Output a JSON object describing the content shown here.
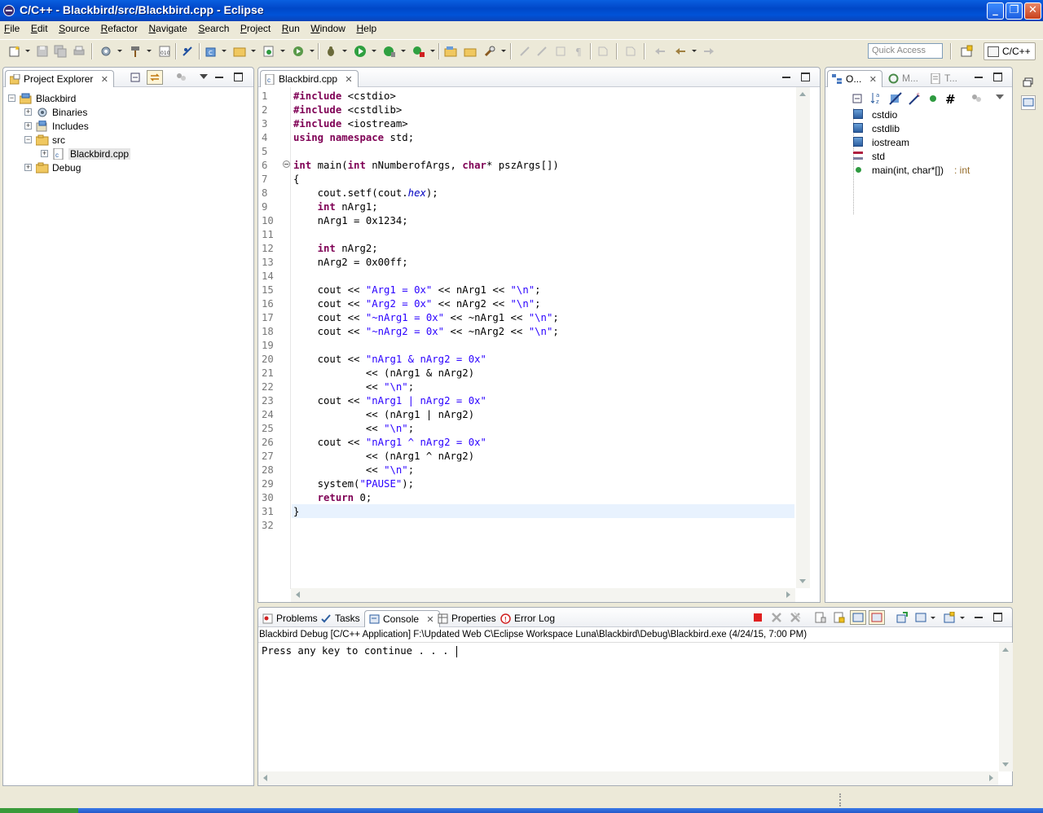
{
  "window": {
    "title": "C/C++ - Blackbird/src/Blackbird.cpp - Eclipse"
  },
  "menu": [
    "File",
    "Edit",
    "Source",
    "Refactor",
    "Navigate",
    "Search",
    "Project",
    "Run",
    "Window",
    "Help"
  ],
  "toolbar": {
    "quick_access_placeholder": "Quick Access",
    "perspective": "C/C++"
  },
  "project_explorer": {
    "tab_label": "Project Explorer",
    "tree": [
      {
        "label": "Blackbird",
        "icon": "project-icon",
        "expanded": true
      },
      {
        "label": "Binaries",
        "icon": "binaries-icon"
      },
      {
        "label": "Includes",
        "icon": "includes-icon"
      },
      {
        "label": "src",
        "icon": "folder-icon",
        "expanded": true
      },
      {
        "label": "Blackbird.cpp",
        "icon": "cpp-file-icon"
      },
      {
        "label": "Debug",
        "icon": "folder-icon"
      }
    ]
  },
  "editor": {
    "tab_label": "Blackbird.cpp",
    "line_numbers": [
      "1",
      "2",
      "3",
      "4",
      "5",
      "6",
      "7",
      "8",
      "9",
      "10",
      "11",
      "12",
      "13",
      "14",
      "15",
      "16",
      "17",
      "18",
      "19",
      "20",
      "21",
      "22",
      "23",
      "24",
      "25",
      "26",
      "27",
      "28",
      "29",
      "30",
      "31",
      "32"
    ],
    "lines": [
      "#include <cstdio>",
      "#include <cstdlib>",
      "#include <iostream>",
      "using namespace std;",
      "",
      "int main(int nNumberofArgs, char* pszArgs[])",
      "{",
      "    cout.setf(cout.hex);",
      "    int nArg1;",
      "    nArg1 = 0x1234;",
      "",
      "    int nArg2;",
      "    nArg2 = 0x00ff;",
      "",
      "    cout << \"Arg1 = 0x\" << nArg1 << \"\\n\";",
      "    cout << \"Arg2 = 0x\" << nArg2 << \"\\n\";",
      "    cout << \"~nArg1 = 0x\" << ~nArg1 << \"\\n\";",
      "    cout << \"~nArg2 = 0x\" << ~nArg2 << \"\\n\";",
      "",
      "    cout << \"nArg1 & nArg2 = 0x\"",
      "            << (nArg1 & nArg2)",
      "            << \"\\n\";",
      "    cout << \"nArg1 | nArg2 = 0x\"",
      "            << (nArg1 | nArg2)",
      "            << \"\\n\";",
      "    cout << \"nArg1 ^ nArg2 = 0x\"",
      "            << (nArg1 ^ nArg2)",
      "            << \"\\n\";",
      "    system(\"PAUSE\");",
      "    return 0;",
      "}",
      ""
    ]
  },
  "outline": {
    "tabs": [
      "O...",
      "M...",
      "T..."
    ],
    "items": [
      {
        "label": "cstdio",
        "icon": "include-icon"
      },
      {
        "label": "cstdlib",
        "icon": "include-icon"
      },
      {
        "label": "iostream",
        "icon": "include-icon"
      },
      {
        "label": "std",
        "icon": "namespace-icon"
      },
      {
        "label": "main(int, char*[])",
        "type": " : int",
        "icon": "function-icon"
      }
    ]
  },
  "bottom": {
    "tabs": [
      "Problems",
      "Tasks",
      "Console",
      "Properties",
      "Error Log"
    ],
    "console_description": "Blackbird Debug [C/C++ Application] F:\\Updated Web C\\Eclipse Workspace Luna\\Blackbird\\Debug\\Blackbird.exe (4/24/15, 7:00 PM)",
    "console_output": "Press any key to continue . . . "
  },
  "colors": {
    "keyword": "#7f0055",
    "string": "#2a00ff",
    "current_line": "#e8f2fe",
    "titlebar": "#0054e3"
  }
}
